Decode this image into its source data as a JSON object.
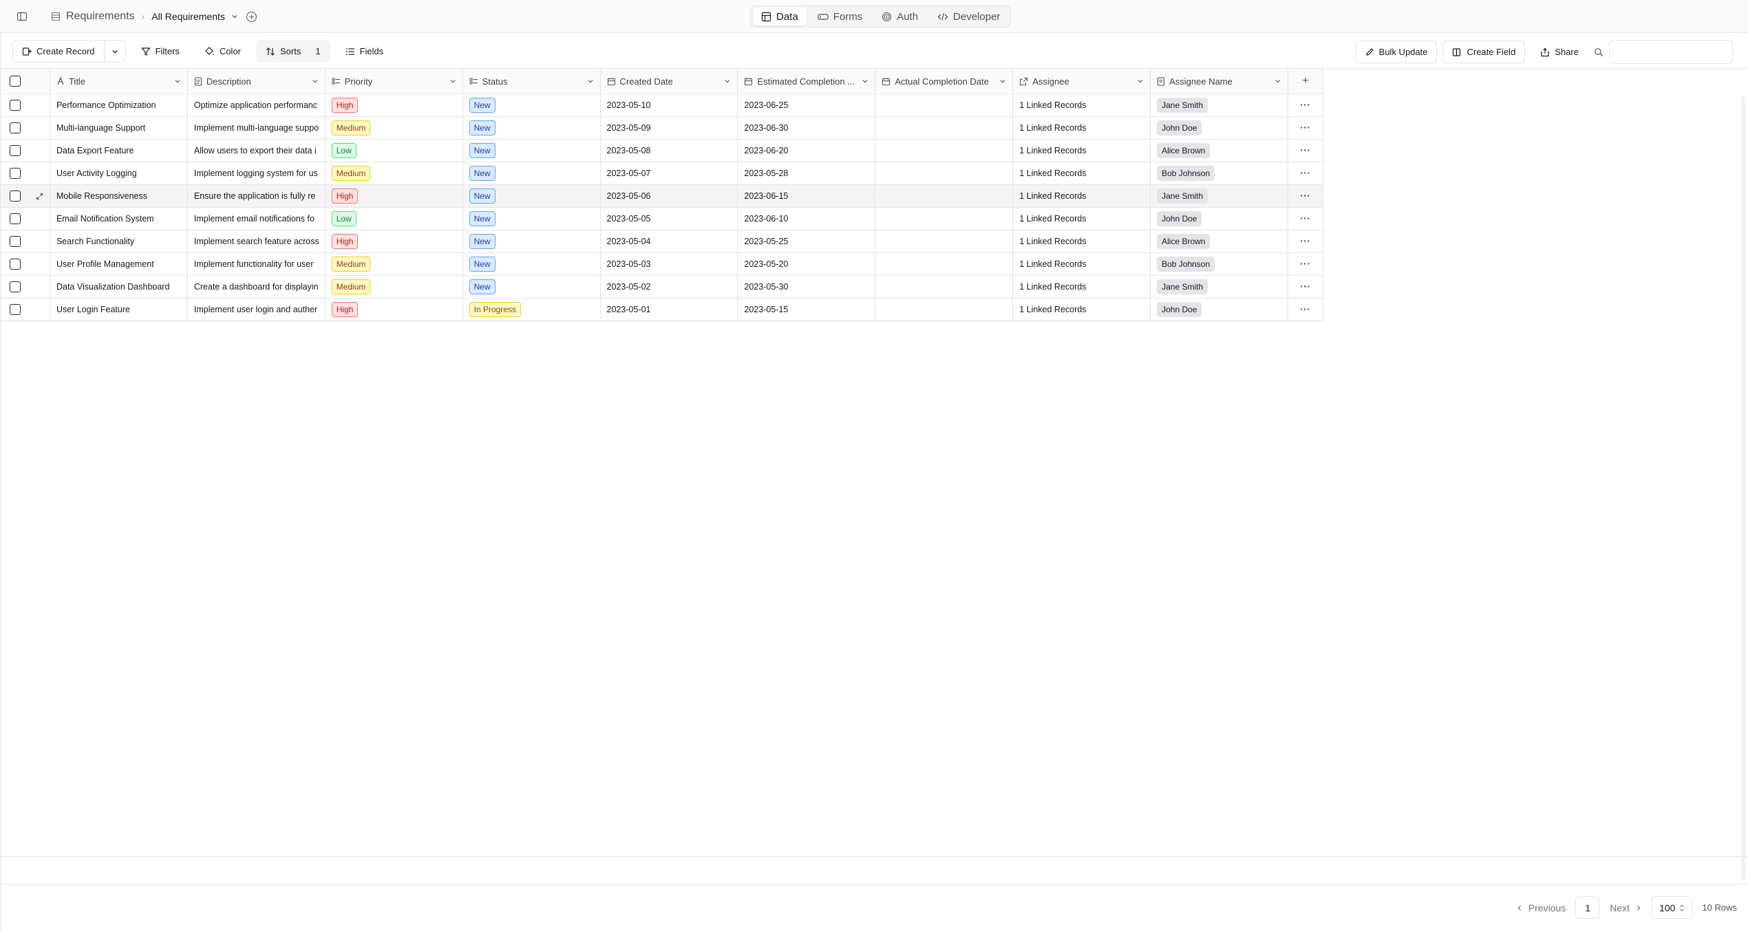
{
  "breadcrumb": {
    "table_name": "Requirements",
    "view_name": "All Requirements"
  },
  "nav_tabs": [
    {
      "label": "Data",
      "icon": "table-icon",
      "active": true
    },
    {
      "label": "Forms",
      "icon": "form-icon",
      "active": false
    },
    {
      "label": "Auth",
      "icon": "fingerprint-icon",
      "active": false
    },
    {
      "label": "Developer",
      "icon": "code-icon",
      "active": false
    }
  ],
  "toolbar": {
    "create_record": "Create Record",
    "filters": "Filters",
    "color": "Color",
    "sorts": "Sorts",
    "sorts_count": "1",
    "fields": "Fields",
    "bulk_update": "Bulk Update",
    "create_field": "Create Field",
    "share": "Share",
    "search_placeholder": ""
  },
  "columns": [
    {
      "label": "Title",
      "icon": "text-icon"
    },
    {
      "label": "Description",
      "icon": "long-text-icon"
    },
    {
      "label": "Priority",
      "icon": "select-icon"
    },
    {
      "label": "Status",
      "icon": "select-icon"
    },
    {
      "label": "Created Date",
      "icon": "calendar-icon"
    },
    {
      "label": "Estimated Completion ...",
      "icon": "calendar-icon"
    },
    {
      "label": "Actual Completion Date",
      "icon": "calendar-icon"
    },
    {
      "label": "Assignee",
      "icon": "link-icon"
    },
    {
      "label": "Assignee Name",
      "icon": "lookup-icon"
    }
  ],
  "rows": [
    {
      "title": "Performance Optimization",
      "description": "Optimize application performanc",
      "priority": "High",
      "status": "New",
      "created": "2023-05-10",
      "estimated": "2023-06-25",
      "actual": "",
      "assignee": "1 Linked Records",
      "assignee_name": "Jane Smith"
    },
    {
      "title": "Multi-language Support",
      "description": "Implement multi-language suppo",
      "priority": "Medium",
      "status": "New",
      "created": "2023-05-09",
      "estimated": "2023-06-30",
      "actual": "",
      "assignee": "1 Linked Records",
      "assignee_name": "John Doe"
    },
    {
      "title": "Data Export Feature",
      "description": "Allow users to export their data i",
      "priority": "Low",
      "status": "New",
      "created": "2023-05-08",
      "estimated": "2023-06-20",
      "actual": "",
      "assignee": "1 Linked Records",
      "assignee_name": "Alice Brown"
    },
    {
      "title": "User Activity Logging",
      "description": "Implement logging system for us",
      "priority": "Medium",
      "status": "New",
      "created": "2023-05-07",
      "estimated": "2023-05-28",
      "actual": "",
      "assignee": "1 Linked Records",
      "assignee_name": "Bob Johnson"
    },
    {
      "title": "Mobile Responsiveness",
      "description": "Ensure the application is fully re",
      "priority": "High",
      "status": "New",
      "created": "2023-05-06",
      "estimated": "2023-06-15",
      "actual": "",
      "assignee": "1 Linked Records",
      "assignee_name": "Jane Smith"
    },
    {
      "title": "Email Notification System",
      "description": "Implement email notifications fo",
      "priority": "Low",
      "status": "New",
      "created": "2023-05-05",
      "estimated": "2023-06-10",
      "actual": "",
      "assignee": "1 Linked Records",
      "assignee_name": "John Doe"
    },
    {
      "title": "Search Functionality",
      "description": "Implement search feature across",
      "priority": "High",
      "status": "New",
      "created": "2023-05-04",
      "estimated": "2023-05-25",
      "actual": "",
      "assignee": "1 Linked Records",
      "assignee_name": "Alice Brown"
    },
    {
      "title": "User Profile Management",
      "description": "Implement functionality for user",
      "priority": "Medium",
      "status": "New",
      "created": "2023-05-03",
      "estimated": "2023-05-20",
      "actual": "",
      "assignee": "1 Linked Records",
      "assignee_name": "Bob Johnson"
    },
    {
      "title": "Data Visualization Dashboard",
      "description": "Create a dashboard for displayin",
      "priority": "Medium",
      "status": "New",
      "created": "2023-05-02",
      "estimated": "2023-05-30",
      "actual": "",
      "assignee": "1 Linked Records",
      "assignee_name": "Jane Smith"
    },
    {
      "title": "User Login Feature",
      "description": "Implement user login and auther",
      "priority": "High",
      "status": "In Progress",
      "created": "2023-05-01",
      "estimated": "2023-05-15",
      "actual": "",
      "assignee": "1 Linked Records",
      "assignee_name": "John Doe"
    }
  ],
  "pagination": {
    "previous": "Previous",
    "page": "1",
    "next": "Next",
    "page_size": "100",
    "row_count": "10 Rows"
  }
}
